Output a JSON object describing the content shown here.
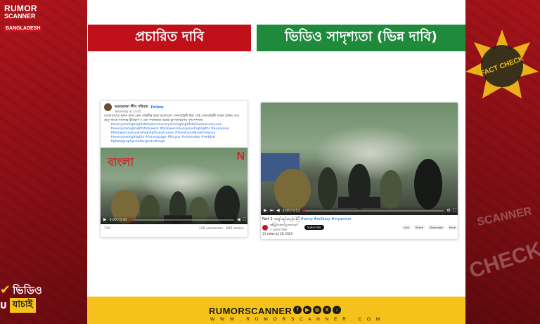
{
  "branding": {
    "logo_line1": "RUMOR",
    "logo_line2": "SCANNER",
    "logo_line3": "BANGLADESH",
    "badge_word1": "ভিডিও",
    "badge_letter": "U",
    "badge_word2": "যাচাই",
    "fact_check_label": "FACT CHECK",
    "stamp_top": "SCANNER",
    "stamp_bottom": "CHECK"
  },
  "headers": {
    "claim": "প্রচারিত দাবি",
    "video_similarity": "ভিডিও সাদৃশ্যতা (ভিন্ন দাবি)"
  },
  "facebook_post": {
    "page_name": "অরতরাজা লীগ পরিবার",
    "follow_label": "Follow",
    "time": "Yesterday at 13:45",
    "text": "বাংলাদেশের সুনাম অর্জ ক্রেপ বাহিনীর দ্বারা বাংলাদেশ সেনাবাহিনী ছিল সেই সেনাবাহিনী সম্মান হানির পথে যেতু আর্মে সবসময় ইতিহাস ঢ় এন্ড সবসময়ত গ্রন্থের স্তুপজাবাসের পুনঃশব্দজয়",
    "hashtags": "#everyonehighlightsfollowersnaveryonehighlightsfolloweranveryone #everyonehighlightsfollowers #followersnaveryonehighlights #everyone #followersaveryonehighlightseveryone #DavshyaaSheikhHasina #everyonehighlights #foryoupage #foryou #viralvideo #reddyb #photographychallengechallenge",
    "overlay_logo": "বাংলা",
    "overlay_n": "N",
    "time_readout": "0:00 / 0:43",
    "reactions": "719",
    "comments": "126 comments",
    "shares": "985 shares"
  },
  "youtube_post": {
    "time_readout": "0:00 / 0:13",
    "title_prefix": "Part 1 အချင်းချင်းပျော်ပါးပြီ",
    "title_tags": "#army #military #myanmar",
    "channel": "စစ်မြင့်ဆောင်မှုဘလော့ဂ်",
    "subscribers": "1 subscriber",
    "subscribe_label": "Subscribe",
    "actions": [
      "Like",
      "Share",
      "Download",
      "Save"
    ],
    "date": "13 views Jul 28, 2023"
  },
  "footer": {
    "brand": "RUMORSCANNER",
    "url": "W W W . R U M O R S C A N N E R . C O M",
    "socials": [
      "f",
      "▶",
      "◎",
      "X",
      "♪"
    ]
  },
  "colors": {
    "claim_red": "#c0101a",
    "similar_green": "#1f8a3b",
    "footer_yellow": "#f4c21a",
    "band_red": "#8c1218"
  }
}
